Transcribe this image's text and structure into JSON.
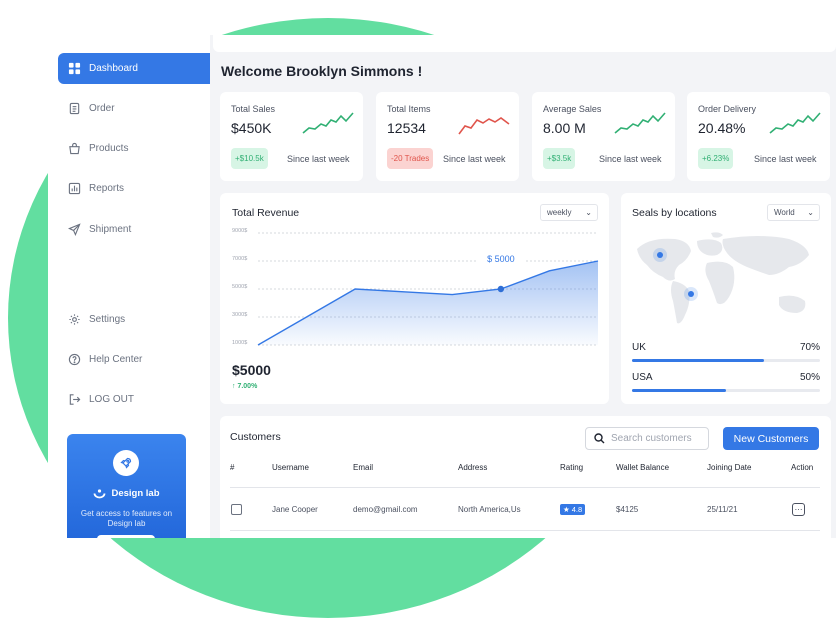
{
  "sidebar": {
    "items": [
      {
        "label": "Dashboard",
        "icon": "grid-icon"
      },
      {
        "label": "Order",
        "icon": "document-icon"
      },
      {
        "label": "Products",
        "icon": "bag-icon"
      },
      {
        "label": "Reports",
        "icon": "chart-icon"
      },
      {
        "label": "Shipment",
        "icon": "send-icon"
      },
      {
        "label": "Settings",
        "icon": "gear-icon"
      },
      {
        "label": "Help Center",
        "icon": "help-icon"
      },
      {
        "label": "LOG OUT",
        "icon": "logout-icon"
      }
    ],
    "promo": {
      "brand": "Design lab",
      "text": "Get access to features on Design lab"
    }
  },
  "header": {
    "welcome": "Welcome Brooklyn Simmons !"
  },
  "stats": [
    {
      "label": "Total Sales",
      "value": "$450K",
      "badge": "+$10.5k",
      "badge_tone": "green",
      "since": "Since last week",
      "trend_color": "#31b074"
    },
    {
      "label": "Total Items",
      "value": "12534",
      "badge": "-20 Trades",
      "badge_tone": "red",
      "since": "Since last week",
      "trend_color": "#e0554c"
    },
    {
      "label": "Average Sales",
      "value": "8.00 M",
      "badge": "+$3.5k",
      "badge_tone": "green",
      "since": "Since last week",
      "trend_color": "#31b074"
    },
    {
      "label": "Order Delivery",
      "value": "20.48%",
      "badge": "+6.23%",
      "badge_tone": "green",
      "since": "Since last week",
      "trend_color": "#31b074"
    }
  ],
  "revenue": {
    "title": "Total Revenue",
    "period": "weekly",
    "total": "$5000",
    "change": "7.00%",
    "tooltip": "$ 5000"
  },
  "chart_data": {
    "type": "area",
    "title": "Total Revenue",
    "yticks": [
      "9000$",
      "7000$",
      "5000$",
      "3000$",
      "1000$"
    ],
    "ylim": [
      1000,
      9000
    ],
    "x": [
      0,
      1,
      2,
      3,
      4,
      5,
      6,
      7
    ],
    "values": [
      1000,
      3000,
      5000,
      4800,
      4600,
      5000,
      6300,
      7000
    ],
    "highlight_index": 5,
    "grid": true,
    "color": "#3478e5"
  },
  "locations": {
    "title": "Seals by locations",
    "region": "World",
    "rows": [
      {
        "name": "UK",
        "value": "70%",
        "fraction": 0.7
      },
      {
        "name": "USA",
        "value": "50%",
        "fraction": 0.5
      }
    ]
  },
  "customers": {
    "title": "Customers",
    "search_placeholder": "Search customers",
    "new_button": "New Customers",
    "columns": [
      "#",
      "Username",
      "Email",
      "Address",
      "Rating",
      "Wallet Balance",
      "Joining Date",
      "Action"
    ],
    "rows": [
      {
        "username": "Jane Cooper",
        "email": "demo@gmail.com",
        "address": "North America,Us",
        "rating": "4.8",
        "wallet": "$4125",
        "joined": "25/11/21"
      }
    ]
  },
  "colors": {
    "accent": "#3478e5",
    "positive": "#31b074",
    "negative": "#e0554c",
    "blob": "#62dea0"
  }
}
